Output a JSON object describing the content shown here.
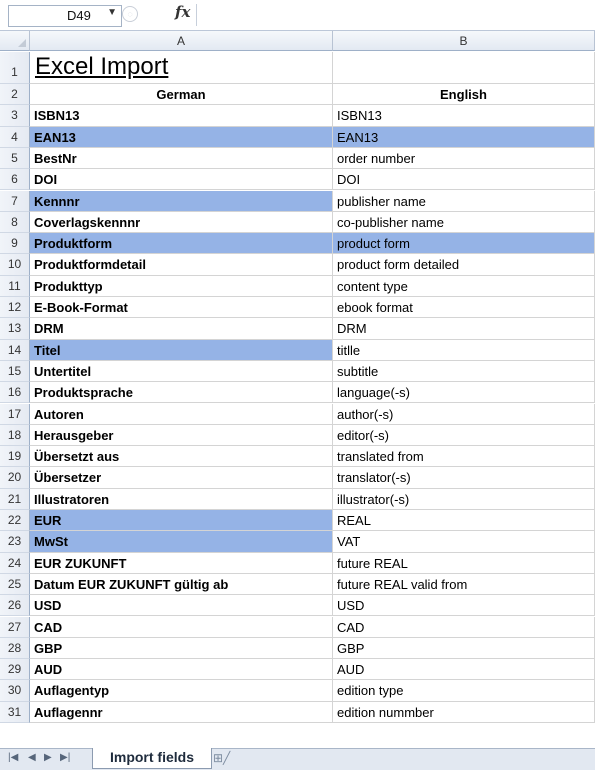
{
  "formula_bar": {
    "name_box": "D49",
    "fx_label": "fx",
    "formula": ""
  },
  "columns": [
    "A",
    "B"
  ],
  "rows": [
    {
      "n": "1",
      "a": "Excel Import",
      "b": "",
      "type": "title"
    },
    {
      "n": "2",
      "a": "German",
      "b": "English",
      "type": "header"
    },
    {
      "n": "3",
      "a": "ISBN13",
      "b": "ISBN13"
    },
    {
      "n": "4",
      "a": "EAN13",
      "b": "EAN13",
      "hl": "both"
    },
    {
      "n": "5",
      "a": "BestNr",
      "b": "order number"
    },
    {
      "n": "6",
      "a": "DOI",
      "b": "DOI"
    },
    {
      "n": "7",
      "a": "Kennnr",
      "b": "publisher name",
      "hl": "a"
    },
    {
      "n": "8",
      "a": "Coverlagskennnr",
      "b": "co-publisher name"
    },
    {
      "n": "9",
      "a": "Produktform",
      "b": "product form",
      "hl": "both"
    },
    {
      "n": "10",
      "a": "Produktformdetail",
      "b": "product form detailed"
    },
    {
      "n": "11",
      "a": "Produkttyp",
      "b": "content type"
    },
    {
      "n": "12",
      "a": "E-Book-Format",
      "b": "ebook format"
    },
    {
      "n": "13",
      "a": "DRM",
      "b": "DRM"
    },
    {
      "n": "14",
      "a": "Titel",
      "b": "titlle",
      "hl": "a"
    },
    {
      "n": "15",
      "a": "Untertitel",
      "b": "subtitle"
    },
    {
      "n": "16",
      "a": "Produktsprache",
      "b": "language(-s)"
    },
    {
      "n": "17",
      "a": "Autoren",
      "b": "author(-s)"
    },
    {
      "n": "18",
      "a": "Herausgeber",
      "b": "editor(-s)"
    },
    {
      "n": "19",
      "a": "Übersetzt aus",
      "b": "translated from"
    },
    {
      "n": "20",
      "a": "Übersetzer",
      "b": "translator(-s)"
    },
    {
      "n": "21",
      "a": "Illustratoren",
      "b": "illustrator(-s)"
    },
    {
      "n": "22",
      "a": "EUR",
      "b": "REAL",
      "hl": "a"
    },
    {
      "n": "23",
      "a": "MwSt",
      "b": "VAT",
      "hl": "a"
    },
    {
      "n": "24",
      "a": "EUR ZUKUNFT",
      "b": "future REAL"
    },
    {
      "n": "25",
      "a": "Datum EUR ZUKUNFT gültig ab",
      "b": "future REAL valid from"
    },
    {
      "n": "26",
      "a": "USD",
      "b": "USD"
    },
    {
      "n": "27",
      "a": "CAD",
      "b": "CAD"
    },
    {
      "n": "28",
      "a": "GBP",
      "b": "GBP"
    },
    {
      "n": "29",
      "a": "AUD",
      "b": "AUD"
    },
    {
      "n": "30",
      "a": "Auflagentyp",
      "b": "edition type"
    },
    {
      "n": "31",
      "a": "Auflagennr",
      "b": "edition nummber"
    }
  ],
  "sheet_tabs": {
    "active": "Import fields"
  },
  "colors": {
    "highlight": "#95b3e6",
    "header_bg": "#e3e9f2"
  }
}
